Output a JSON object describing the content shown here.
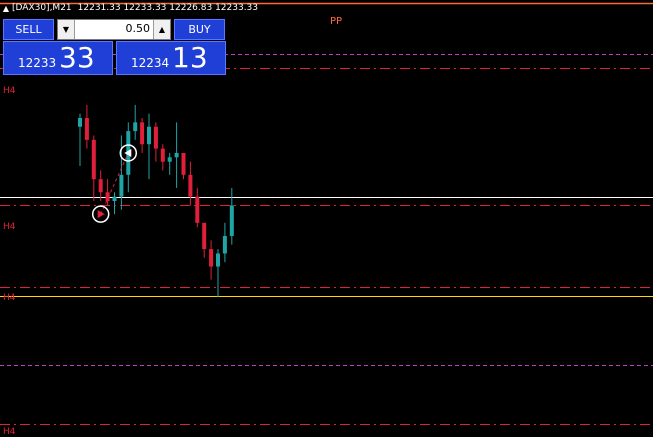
{
  "header": {
    "collapse_arrow": "▲",
    "symbol_timeframe": "[DAX30],M21",
    "ohlc": "12231.33 12233.33 12226.83 12233.33"
  },
  "trade_panel": {
    "sell_label": "SELL",
    "buy_label": "BUY",
    "lot_value": "0.50",
    "lot_down_icon": "▼",
    "lot_up_icon": "▲",
    "bid_prefix": "12233",
    "bid_big": "33",
    "ask_prefix": "12234",
    "ask_big": "13"
  },
  "levels": {
    "pp_label": "PP",
    "h4_label_1": "H4",
    "h4_label_2": "H4",
    "h4_label_3": "H4",
    "h4_label_4": "H4"
  },
  "colors": {
    "background": "#000000",
    "bull_candle": "#1fa5a5",
    "bear_candle": "#e0203a",
    "pp_line": "#ff6a3d",
    "dash_red": "#e0203a",
    "dash_magenta": "#c43cc4",
    "price_line_white": "#ffffff",
    "price_line_yellow": "#ffd700",
    "panel_blue": "#1f3fd6"
  },
  "chart_data": {
    "type": "candlestick",
    "ohlc": [
      {
        "o": 12230.5,
        "h": 12232.0,
        "l": 12226.0,
        "c": 12231.5
      },
      {
        "o": 12231.5,
        "h": 12233.0,
        "l": 12228.0,
        "c": 12229.0
      },
      {
        "o": 12229.0,
        "h": 12229.5,
        "l": 12222.0,
        "c": 12224.5
      },
      {
        "o": 12224.5,
        "h": 12225.5,
        "l": 12222.0,
        "c": 12223.0
      },
      {
        "o": 12223.0,
        "h": 12224.5,
        "l": 12221.5,
        "c": 12222.0
      },
      {
        "o": 12222.0,
        "h": 12223.0,
        "l": 12220.5,
        "c": 12222.5
      },
      {
        "o": 12222.5,
        "h": 12229.5,
        "l": 12221.0,
        "c": 12225.0
      },
      {
        "o": 12225.0,
        "h": 12231.0,
        "l": 12223.0,
        "c": 12230.0
      },
      {
        "o": 12230.0,
        "h": 12233.0,
        "l": 12229.0,
        "c": 12231.0
      },
      {
        "o": 12231.0,
        "h": 12231.5,
        "l": 12227.5,
        "c": 12228.5
      },
      {
        "o": 12228.5,
        "h": 12232.0,
        "l": 12224.5,
        "c": 12230.5
      },
      {
        "o": 12230.5,
        "h": 12231.0,
        "l": 12226.5,
        "c": 12228.0
      },
      {
        "o": 12228.0,
        "h": 12228.5,
        "l": 12225.5,
        "c": 12226.5
      },
      {
        "o": 12226.5,
        "h": 12227.5,
        "l": 12225.0,
        "c": 12227.0
      },
      {
        "o": 12227.0,
        "h": 12231.0,
        "l": 12223.5,
        "c": 12227.5
      },
      {
        "o": 12227.5,
        "h": 12227.5,
        "l": 12224.5,
        "c": 12225.0
      },
      {
        "o": 12225.0,
        "h": 12226.5,
        "l": 12221.5,
        "c": 12222.5
      },
      {
        "o": 12222.5,
        "h": 12223.5,
        "l": 12219.0,
        "c": 12219.5
      },
      {
        "o": 12219.5,
        "h": 12219.5,
        "l": 12215.5,
        "c": 12216.5
      },
      {
        "o": 12216.5,
        "h": 12217.5,
        "l": 12213.0,
        "c": 12214.5
      },
      {
        "o": 12214.5,
        "h": 12216.5,
        "l": 12211.0,
        "c": 12216.0
      },
      {
        "o": 12216.0,
        "h": 12219.5,
        "l": 12215.0,
        "c": 12218.0
      },
      {
        "o": 12218.0,
        "h": 12223.5,
        "l": 12217.0,
        "c": 12221.5
      }
    ],
    "price_axis": [
      12195.0,
      12245.0
    ],
    "levels": {
      "pp": 12244.6,
      "h4_1": 12237.2,
      "h4_2": 12221.5,
      "h4_3": 12212.2,
      "h4_4": 12196.5,
      "dashed_red_1": 12238.8,
      "dashed_magenta": 12203.2,
      "bid_line": 12222.5,
      "yellow_line": 12211.1
    },
    "arrows": [
      {
        "bar": 3,
        "price": 12220.5,
        "dir": "buy",
        "color": "#e0203a"
      },
      {
        "bar": 7,
        "price": 12227.5,
        "dir": "sell",
        "color": "#ffffff"
      }
    ]
  }
}
